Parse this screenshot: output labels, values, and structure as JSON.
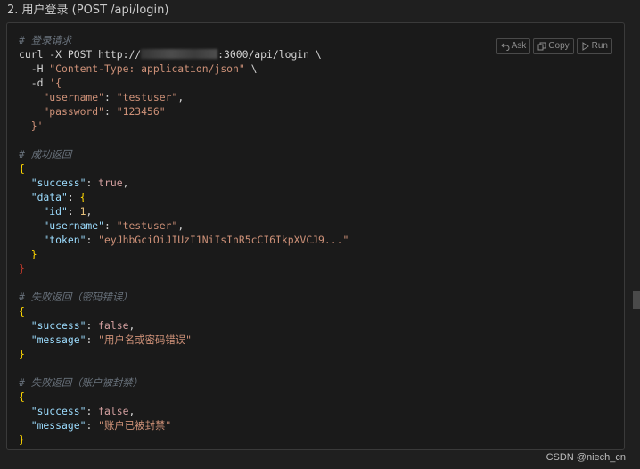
{
  "heading": "2. 用户登录 (POST /api/login)",
  "actions": [
    {
      "label": "Ask",
      "icon": "undo-arrow-icon"
    },
    {
      "label": "Copy",
      "icon": "copy-icon"
    },
    {
      "label": "Run",
      "icon": "play-icon"
    }
  ],
  "code": {
    "c1": "# 登录请求",
    "curl": "curl -X POST http://",
    "url_tail": ":3000/api/login \\",
    "h_flag": "  -H ",
    "h_val": "\"Content-Type: application/json\"",
    "h_tail": " \\",
    "d_flag": "  -d ",
    "d_open": "'{",
    "u_key": "    \"username\"",
    "u_val": "\"testuser\"",
    "p_key": "    \"password\"",
    "p_val": "\"123456\"",
    "d_close": "  }'",
    "c2": "# 成功返回",
    "success_key": "  \"success\"",
    "true_val": "true",
    "data_key": "  \"data\"",
    "id_key": "    \"id\"",
    "id_val": "1",
    "uname_key": "    \"username\"",
    "uname_val": "\"testuser\"",
    "token_key": "    \"token\"",
    "token_val": "\"eyJhbGciOiJIUzI1NiIsInR5cCI6IkpXVCJ9...\"",
    "c3": "# 失败返回（密码错误）",
    "false_val": "false",
    "message_key": "  \"message\"",
    "msg1": "\"用户名或密码错误\"",
    "c4": "# 失败返回（账户被封禁）",
    "msg2": "\"账户已被封禁\""
  },
  "watermark": "CSDN @niech_cn"
}
